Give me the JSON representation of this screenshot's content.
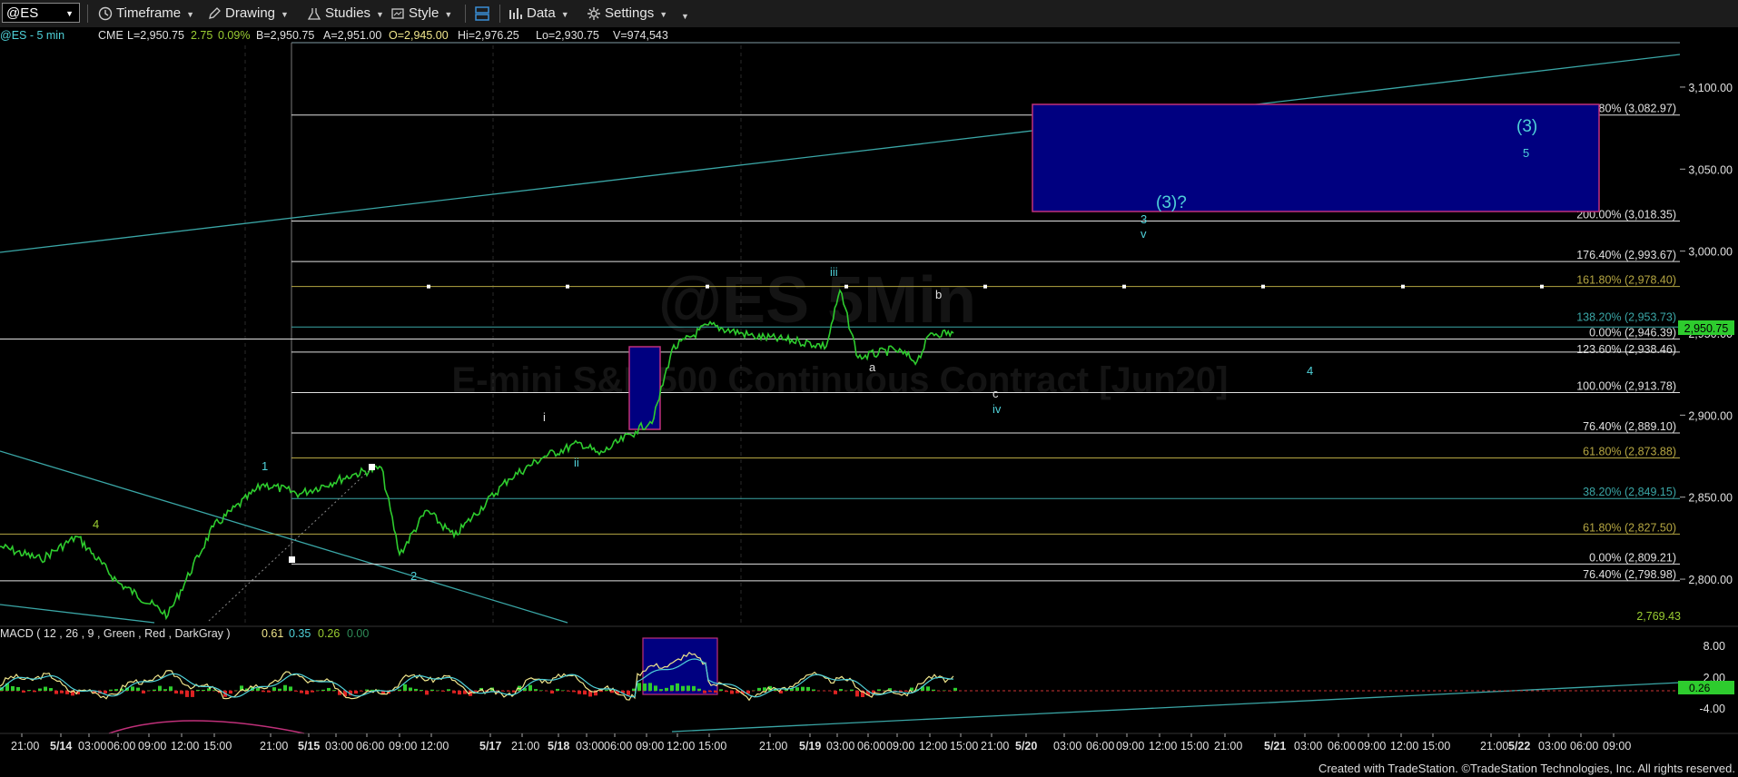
{
  "toolbar": {
    "symbol": "@ES",
    "timeframe_label": "Timeframe",
    "drawing_label": "Drawing",
    "studies_label": "Studies",
    "style_label": "Style",
    "data_label": "Data",
    "settings_label": "Settings"
  },
  "quote": {
    "symbol": "@ES - 5 min",
    "exchange": "CME",
    "last": "L=2,950.75",
    "change": "2.75",
    "change_pct": "0.09%",
    "bid": "B=2,950.75",
    "ask": "A=2,951.00",
    "open": "O=2,945.00",
    "high": "Hi=2,976.25",
    "low": "Lo=2,930.75",
    "volume": "V=974,543"
  },
  "watermark": {
    "symbol": "@ES 5Min",
    "name": "E-mini S&P 500 Continuous Contract [Jun20]"
  },
  "fib_levels": [
    {
      "label": "261.80% (3,082.97)",
      "price": 3082.97,
      "color": "#e0e0e0"
    },
    {
      "label": "200.00% (3,018.35)",
      "price": 3018.35,
      "color": "#e0e0e0"
    },
    {
      "label": "176.40% (2,993.67)",
      "price": 2993.67,
      "color": "#e0e0e0"
    },
    {
      "label": "161.80% (2,978.40)",
      "price": 2978.4,
      "color": "#b5a642"
    },
    {
      "label": "138.20% (2,953.73)",
      "price": 2953.73,
      "color": "#3aa6a6"
    },
    {
      "label": "0.00% (2,946.39)",
      "price": 2946.39,
      "color": "#e0e0e0"
    },
    {
      "label": "123.60% (2,938.46)",
      "price": 2938.46,
      "color": "#e0e0e0"
    },
    {
      "label": "100.00% (2,913.78)",
      "price": 2913.78,
      "color": "#e0e0e0"
    },
    {
      "label": "76.40% (2,889.10)",
      "price": 2889.1,
      "color": "#e0e0e0"
    },
    {
      "label": "61.80% (2,873.88)",
      "price": 2873.88,
      "color": "#b5a642"
    },
    {
      "label": "38.20% (2,849.15)",
      "price": 2849.15,
      "color": "#3aa6a6"
    },
    {
      "label": "61.80% (2,827.50)",
      "price": 2827.5,
      "color": "#b5a642"
    },
    {
      "label": "0.00% (2,809.21)",
      "price": 2809.21,
      "color": "#e0e0e0"
    },
    {
      "label": "76.40% (2,798.98)",
      "price": 2798.98,
      "color": "#e0e0e0"
    }
  ],
  "price_axis": {
    "ticks": [
      "3,100.00",
      "3,050.00",
      "3,000.00",
      "2,950.00",
      "2,900.00",
      "2,850.00",
      "2,800.00"
    ],
    "current_price": "2,950.75",
    "lowest_label": "2,769.43"
  },
  "time_axis": {
    "ticks": [
      "21:00",
      "5/14",
      "03:00",
      "06:00",
      "09:00",
      "12:00",
      "15:00",
      "21:00",
      "5/15",
      "03:00",
      "06:00",
      "09:00",
      "12:00",
      "5/17",
      "21:00",
      "5/18",
      "03:00",
      "06:00",
      "09:00",
      "12:00",
      "15:00",
      "21:00",
      "5/19",
      "03:00",
      "06:00",
      "09:00",
      "12:00",
      "15:00",
      "21:00",
      "5/20",
      "03:00",
      "06:00",
      "09:00",
      "12:00",
      "15:00",
      "21:00",
      "5/21",
      "03:00",
      "06:00",
      "09:00",
      "12:00",
      "15:00",
      "21:00",
      "5/22",
      "03:00",
      "06:00",
      "09:00"
    ]
  },
  "wave_labels": [
    {
      "text": "4",
      "color": "#9acd32"
    },
    {
      "text": "1",
      "color": "#4fd1d9"
    },
    {
      "text": "2",
      "color": "#4fd1d9"
    },
    {
      "text": "i",
      "color": "#e0e0e0"
    },
    {
      "text": "ii",
      "color": "#4fd1d9"
    },
    {
      "text": "iii",
      "color": "#4fd1d9"
    },
    {
      "text": "a",
      "color": "#e0e0e0"
    },
    {
      "text": "b",
      "color": "#e0e0e0"
    },
    {
      "text": "c",
      "color": "#e0e0e0"
    },
    {
      "text": "iv",
      "color": "#4fd1d9"
    },
    {
      "text": "3",
      "color": "#4fd1d9"
    },
    {
      "text": "v",
      "color": "#4fd1d9"
    },
    {
      "text": "(3)?",
      "color": "#4fd1d9"
    },
    {
      "text": "4",
      "color": "#4fd1d9"
    },
    {
      "text": "(3)",
      "color": "#4fd1d9"
    },
    {
      "text": "5",
      "color": "#4fd1d9"
    }
  ],
  "macd": {
    "label": "MACD ( 12 , 26 , 9 , Green , Red , DarkGray )",
    "values": [
      "0.61",
      "0.35",
      "0.26",
      "0.00"
    ],
    "value_colors": [
      "#f0e68c",
      "#4fd1d9",
      "#9acd32",
      "#2e8b57"
    ],
    "ticks": [
      "8.00",
      "2.00",
      "-4.00"
    ],
    "current": "0.26"
  },
  "footer": "Created with TradeStation. ©TradeStation Technologies, Inc. All rights reserved.",
  "chart_data": {
    "type": "line",
    "title": "@ES - 5 min",
    "ylabel": "",
    "ylim": [
      2760,
      3118
    ],
    "x": [
      "5/14 00:00",
      "5/14 04:00",
      "5/14 07:00",
      "5/14 09:30",
      "5/14 12:00",
      "5/14 14:00",
      "5/14 18:30",
      "5/15 00:30",
      "5/15 03:30",
      "5/15 06:00",
      "5/15 08:00",
      "5/15 10:00",
      "5/15 12:00",
      "5/17 18:00",
      "5/17 22:00",
      "5/18 01:00",
      "5/18 03:00",
      "5/18 06:00",
      "5/18 07:30",
      "5/18 09:00",
      "5/18 12:00",
      "5/18 15:00",
      "5/18 21:00",
      "5/19 01:00",
      "5/19 02:30",
      "5/19 04:30",
      "5/19 07:00",
      "5/19 09:00",
      "5/19 11:00",
      "5/19 13:00"
    ],
    "series": [
      {
        "values": [
          2820,
          2812,
          2826,
          2798,
          2778,
          2832,
          2858,
          2852,
          2864,
          2868,
          2815,
          2842,
          2826,
          2861,
          2875,
          2883,
          2876,
          2890,
          2898,
          2940,
          2955,
          2948,
          2945,
          2942,
          2976,
          2935,
          2940,
          2933,
          2950,
          2950
        ]
      }
    ]
  }
}
